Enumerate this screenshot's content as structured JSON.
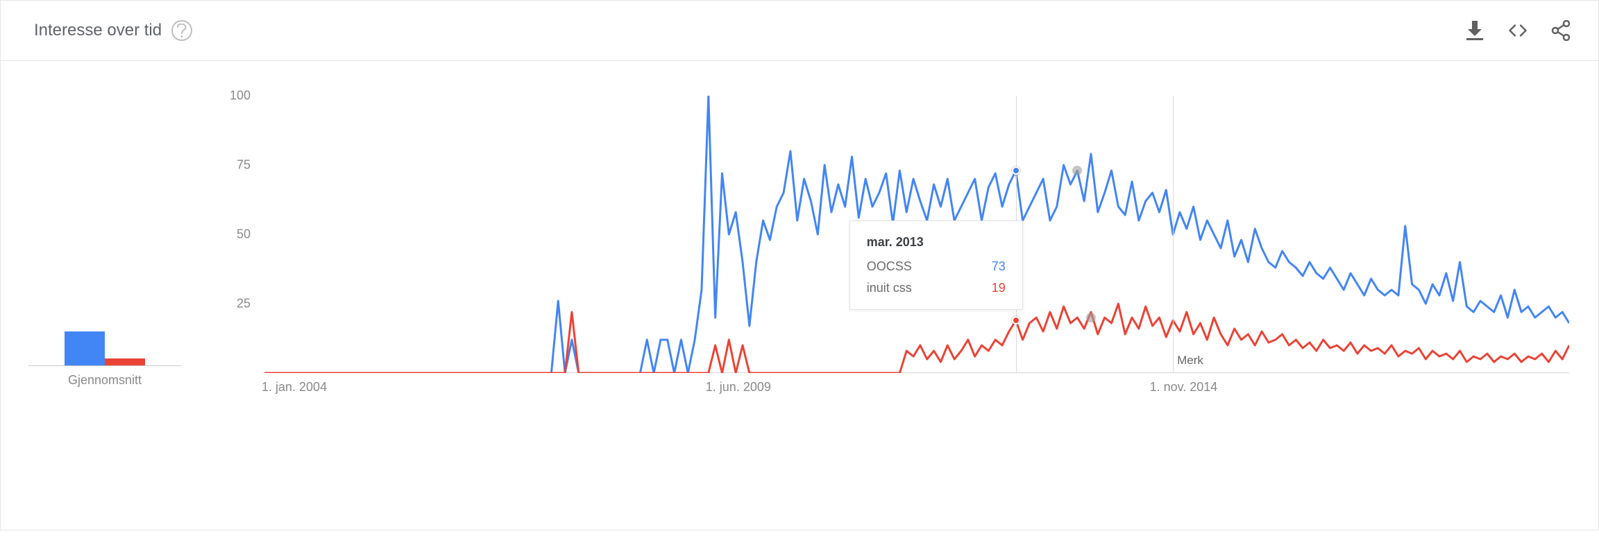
{
  "header": {
    "title": "Interesse over tid",
    "help_tooltip": "?"
  },
  "actions": {
    "download_name": "download-icon",
    "embed_name": "embed-icon",
    "share_name": "share-icon"
  },
  "average": {
    "label": "Gjennomsnitt",
    "series": [
      {
        "name": "OOCSS",
        "value": 33,
        "color": "#4285f4"
      },
      {
        "name": "inuit css",
        "value": 7,
        "color": "#ea4335"
      }
    ]
  },
  "tooltip": {
    "date": "mar. 2013",
    "rows": [
      {
        "name": "OOCSS",
        "value": 73,
        "color": "#4285f4"
      },
      {
        "name": "inuit css",
        "value": 19,
        "color": "#ea4335"
      }
    ]
  },
  "note": {
    "label": "Merk"
  },
  "chart_data": {
    "type": "line",
    "title": "Interesse over tid",
    "ylabel": "",
    "xlabel": "",
    "ylim": [
      0,
      100
    ],
    "yticks": [
      25,
      50,
      75,
      100
    ],
    "x_start": "2004-01",
    "x_end": "2019-12",
    "x_tick_labels": [
      "1. jan. 2004",
      "1. jun. 2009",
      "1. nov. 2014"
    ],
    "x_tick_positions_months": [
      0,
      65,
      130
    ],
    "total_months": 192,
    "hover_month_index": 110,
    "note_month_index": 133,
    "ghost_markers": [
      {
        "series": "OOCSS",
        "month": 119,
        "value": 73
      },
      {
        "series": "inuit css",
        "month": 121,
        "value": 20
      }
    ],
    "series": [
      {
        "name": "OOCSS",
        "color": "#4285f4",
        "average": 33,
        "values": [
          0,
          0,
          0,
          0,
          0,
          0,
          0,
          0,
          0,
          0,
          0,
          0,
          0,
          0,
          0,
          0,
          0,
          0,
          0,
          0,
          0,
          0,
          0,
          0,
          0,
          0,
          0,
          0,
          0,
          0,
          0,
          0,
          0,
          0,
          0,
          0,
          0,
          0,
          0,
          0,
          0,
          0,
          0,
          26,
          0,
          12,
          0,
          0,
          0,
          0,
          0,
          0,
          0,
          0,
          0,
          0,
          12,
          0,
          12,
          12,
          0,
          12,
          0,
          12,
          30,
          100,
          20,
          72,
          50,
          58,
          40,
          17,
          40,
          55,
          48,
          60,
          65,
          80,
          55,
          70,
          62,
          50,
          75,
          58,
          68,
          60,
          78,
          56,
          70,
          60,
          65,
          72,
          54,
          73,
          58,
          70,
          62,
          55,
          68,
          60,
          70,
          55,
          60,
          65,
          70,
          55,
          67,
          72,
          60,
          68,
          73,
          55,
          60,
          65,
          70,
          55,
          60,
          75,
          68,
          73,
          62,
          79,
          58,
          65,
          73,
          60,
          57,
          69,
          55,
          62,
          65,
          58,
          66,
          50,
          58,
          52,
          60,
          48,
          55,
          50,
          45,
          55,
          42,
          48,
          40,
          52,
          45,
          40,
          38,
          44,
          40,
          38,
          35,
          40,
          36,
          34,
          38,
          34,
          30,
          36,
          32,
          28,
          34,
          30,
          28,
          30,
          28,
          53,
          32,
          30,
          25,
          32,
          28,
          36,
          26,
          40,
          24,
          22,
          26,
          24,
          22,
          28,
          20,
          30,
          22,
          24,
          20,
          22,
          24,
          20,
          22,
          18
        ]
      },
      {
        "name": "inuit css",
        "color": "#ea4335",
        "average": 7,
        "values": [
          0,
          0,
          0,
          0,
          0,
          0,
          0,
          0,
          0,
          0,
          0,
          0,
          0,
          0,
          0,
          0,
          0,
          0,
          0,
          0,
          0,
          0,
          0,
          0,
          0,
          0,
          0,
          0,
          0,
          0,
          0,
          0,
          0,
          0,
          0,
          0,
          0,
          0,
          0,
          0,
          0,
          0,
          0,
          0,
          0,
          22,
          0,
          0,
          0,
          0,
          0,
          0,
          0,
          0,
          0,
          0,
          0,
          0,
          0,
          0,
          0,
          0,
          0,
          0,
          0,
          0,
          10,
          0,
          12,
          0,
          10,
          0,
          0,
          0,
          0,
          0,
          0,
          0,
          0,
          0,
          0,
          0,
          0,
          0,
          0,
          0,
          0,
          0,
          0,
          0,
          0,
          0,
          0,
          0,
          8,
          6,
          10,
          5,
          8,
          4,
          10,
          5,
          8,
          12,
          6,
          10,
          8,
          12,
          10,
          15,
          19,
          12,
          18,
          20,
          15,
          22,
          16,
          24,
          18,
          20,
          16,
          22,
          14,
          20,
          18,
          25,
          14,
          20,
          16,
          24,
          17,
          20,
          13,
          19,
          15,
          22,
          14,
          18,
          12,
          20,
          14,
          10,
          16,
          12,
          14,
          10,
          15,
          11,
          12,
          14,
          10,
          12,
          9,
          11,
          8,
          12,
          9,
          10,
          8,
          11,
          7,
          10,
          8,
          9,
          7,
          10,
          6,
          8,
          7,
          9,
          5,
          8,
          6,
          7,
          5,
          8,
          4,
          6,
          5,
          7,
          4,
          6,
          5,
          7,
          4,
          6,
          5,
          7,
          4,
          8,
          5,
          10
        ]
      }
    ]
  }
}
